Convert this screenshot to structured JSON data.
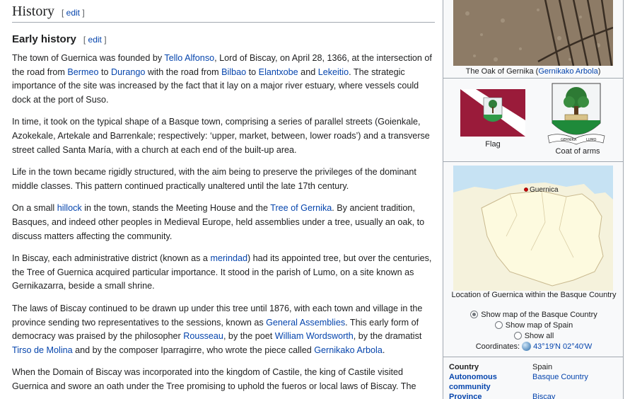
{
  "section": {
    "title": "History",
    "edit_label": "edit"
  },
  "subsection": {
    "title": "Early history",
    "edit_label": "edit"
  },
  "paragraphs": [
    [
      {
        "t": "The town of Guernica was founded by "
      },
      {
        "t": "Tello Alfonso",
        "link": true
      },
      {
        "t": ", Lord of Biscay, on April 28, 1366, at the intersection of the road from "
      },
      {
        "t": "Bermeo",
        "link": true
      },
      {
        "t": " to "
      },
      {
        "t": "Durango",
        "link": true
      },
      {
        "t": " with the road from "
      },
      {
        "t": "Bilbao",
        "link": true
      },
      {
        "t": " to "
      },
      {
        "t": "Elantxobe",
        "link": true
      },
      {
        "t": " and "
      },
      {
        "t": "Lekeitio",
        "link": true
      },
      {
        "t": ". The strategic importance of the site was increased by the fact that it lay on a major river estuary, where vessels could dock at the port of Suso."
      }
    ],
    [
      {
        "t": "In time, it took on the typical shape of a Basque town, comprising a series of parallel streets (Goienkale, Azokekale, Artekale and Barrenkale; respectively: ‘upper, market, between, lower roads’) and a transverse street called Santa María, with a church at each end of the built-up area."
      }
    ],
    [
      {
        "t": "Life in the town became rigidly structured, with the aim being to preserve the privileges of the dominant middle classes. This pattern continued practically unaltered until the late 17th century."
      }
    ],
    [
      {
        "t": "On a small "
      },
      {
        "t": "hillock",
        "link": true
      },
      {
        "t": " in the town, stands the Meeting House and the "
      },
      {
        "t": "Tree of Gernika",
        "link": true
      },
      {
        "t": ". By ancient tradition, Basques, and indeed other peoples in Medieval Europe, held assemblies under a tree, usually an oak, to discuss matters affecting the community."
      }
    ],
    [
      {
        "t": "In Biscay, each administrative district (known as a "
      },
      {
        "t": "merindad",
        "link": true
      },
      {
        "t": ") had its appointed tree, but over the centuries, the Tree of Guernica acquired particular importance. It stood in the parish of Lumo, on a site known as Gernikazarra, beside a small shrine."
      }
    ],
    [
      {
        "t": "The laws of Biscay continued to be drawn up under this tree until 1876, with each town and village in the province sending two representatives to the sessions, known as "
      },
      {
        "t": "General Assemblies",
        "link": true
      },
      {
        "t": ". This early form of democracy was praised by the philosopher "
      },
      {
        "t": "Rousseau",
        "link": true
      },
      {
        "t": ", by the poet "
      },
      {
        "t": "William Wordsworth",
        "link": true
      },
      {
        "t": ", by the dramatist "
      },
      {
        "t": "Tirso de Molina",
        "link": true
      },
      {
        "t": " and by the composer Iparragirre, who wrote the piece called "
      },
      {
        "t": "Gernikako Arbola",
        "link": true
      },
      {
        "t": "."
      }
    ],
    [
      {
        "t": "When the Domain of Biscay was incorporated into the kingdom of Castile, the king of Castile visited Guernica and swore an oath under the Tree promising to uphold the fueros or local laws of Biscay. The"
      }
    ]
  ],
  "infobox": {
    "oak_caption_prefix": "The Oak of Gernika (",
    "oak_caption_link": "Gernikako Arbola",
    "oak_caption_suffix": ")",
    "flag_label": "Flag",
    "coa_label": "Coat of arms",
    "coa_ribbon_left": "GERNIKA",
    "coa_ribbon_right": "LUMO",
    "map_marker_label": "Guernica",
    "map_caption": "Location of Guernica within the Basque Country",
    "map_options": [
      "Show map of the Basque Country",
      "Show map of Spain",
      "Show all"
    ],
    "map_selected": 0,
    "coordinates_label": "Coordinates:",
    "coordinates_value": "43°19′N 02°40′W",
    "rows": [
      {
        "label": "Country",
        "value": "Spain",
        "label_link": false,
        "value_link": false
      },
      {
        "label": "Autonomous community",
        "value": "Basque Country",
        "label_link": true,
        "value_link": true
      },
      {
        "label": "Province",
        "value": "Biscay",
        "label_link": true,
        "value_link": true
      }
    ]
  },
  "colors": {
    "link": "#0645ad",
    "text": "#202122",
    "border": "#a2a9b1",
    "infobox_bg": "#f8f9fa",
    "flag_red": "#9a1b3a",
    "coa_green": "#1f8a3a",
    "map_land": "#fdfadf"
  }
}
